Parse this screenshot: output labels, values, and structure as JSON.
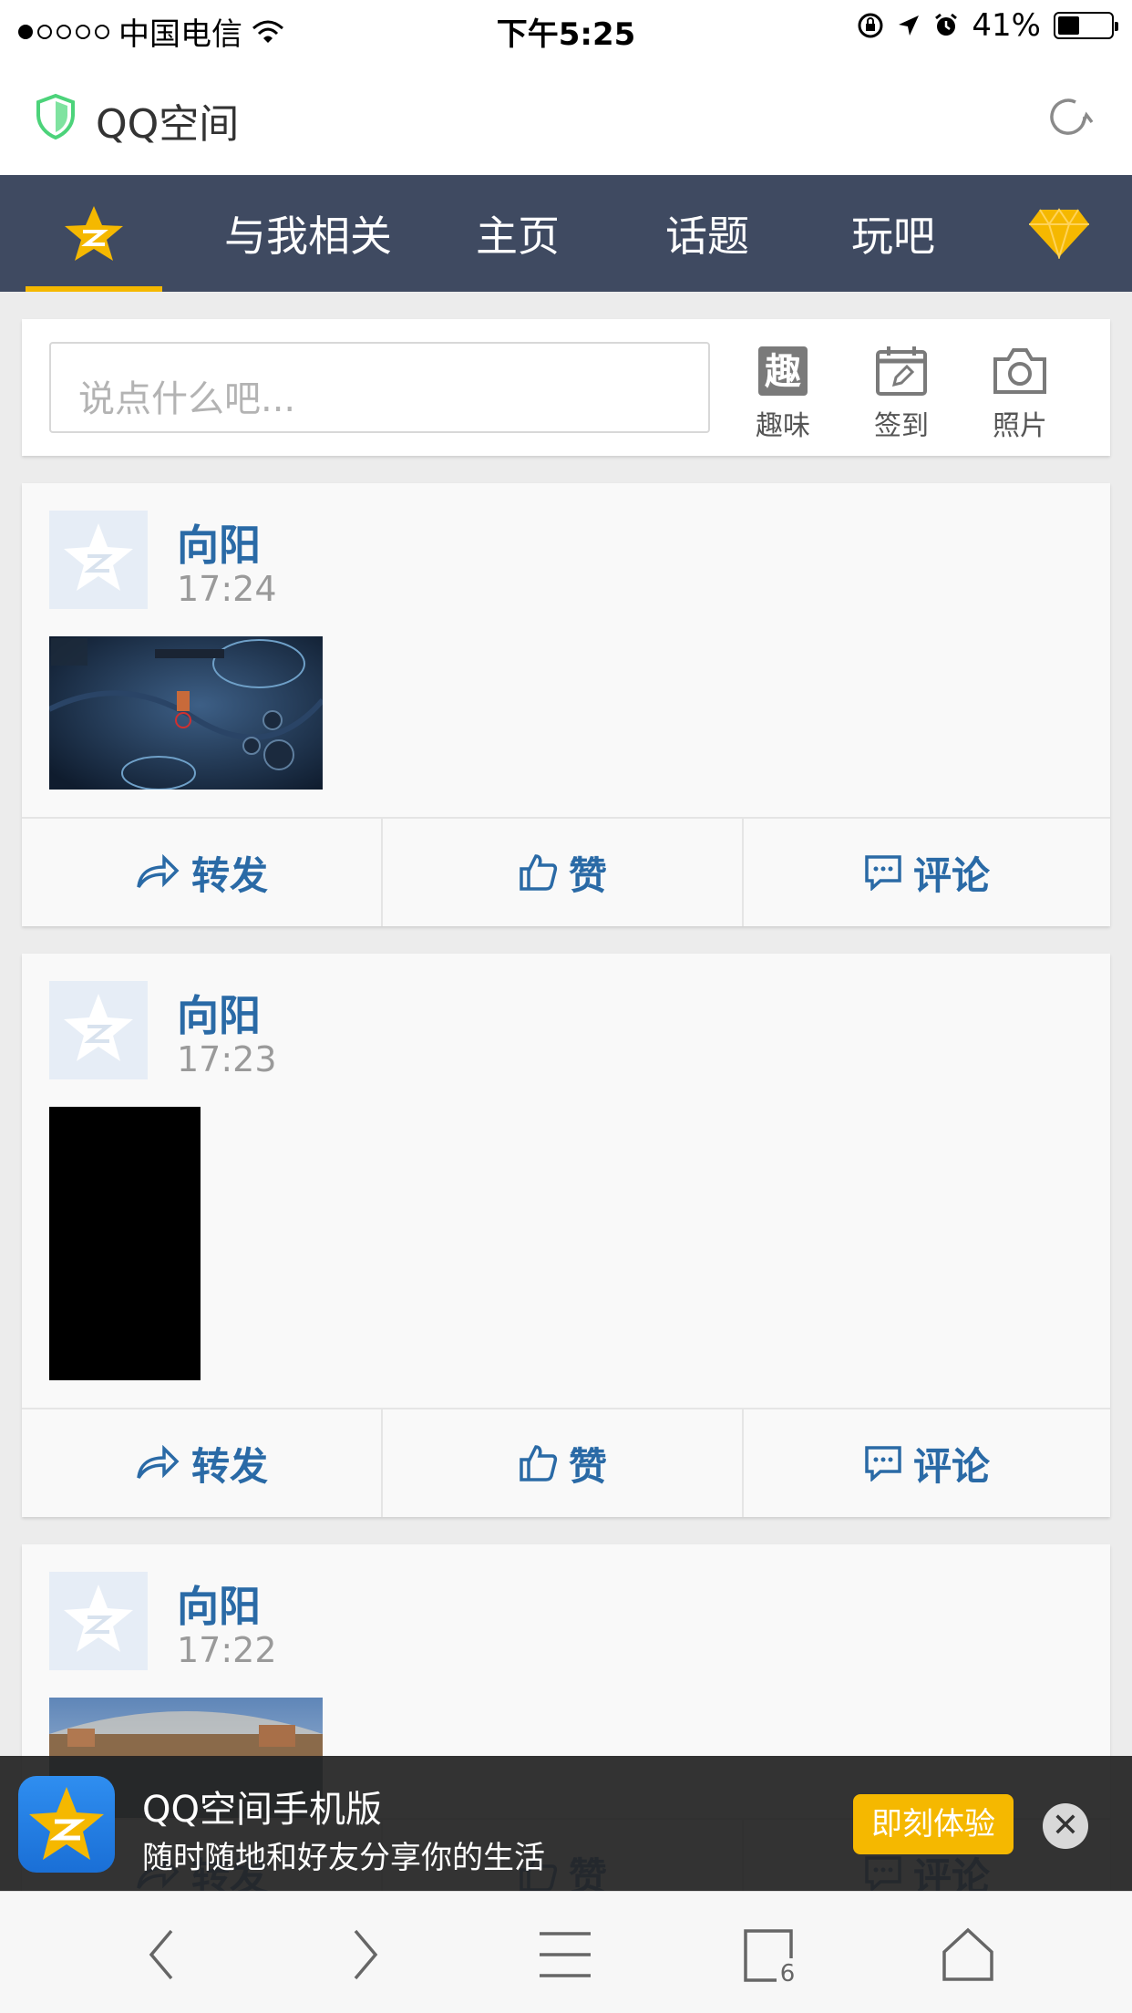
{
  "status_bar": {
    "carrier": "中国电信",
    "time": "下午5:25",
    "battery_percent": "41%",
    "battery_level": 0.41
  },
  "browser": {
    "page_title": "QQ空间"
  },
  "nav": {
    "tabs": [
      "与我相关",
      "主页",
      "话题",
      "玩吧"
    ]
  },
  "composer": {
    "placeholder": "说点什么吧...",
    "actions": {
      "fun": {
        "glyph": "趣",
        "label": "趣味"
      },
      "checkin": {
        "label": "签到"
      },
      "photo": {
        "label": "照片"
      }
    }
  },
  "feed": {
    "posts": [
      {
        "author": "向阳",
        "time": "17:24"
      },
      {
        "author": "向阳",
        "time": "17:23"
      },
      {
        "author": "向阳",
        "time": "17:22"
      }
    ],
    "actions": {
      "forward": "转发",
      "like": "赞",
      "comment": "评论"
    }
  },
  "promo": {
    "title": "QQ空间手机版",
    "subtitle": "随时随地和好友分享你的生活",
    "cta": "即刻体验",
    "close": "✕"
  },
  "toolbar": {
    "tab_count": "6"
  },
  "colors": {
    "nav_bg": "#3f4a61",
    "accent_yellow": "#f5b800",
    "link_blue": "#2a6aa6"
  }
}
